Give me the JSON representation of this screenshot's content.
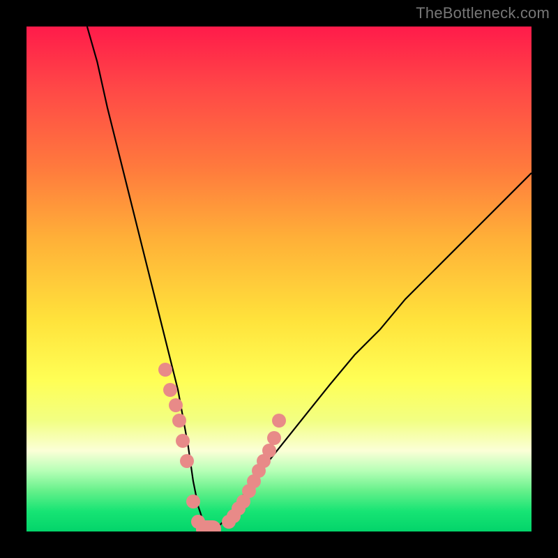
{
  "watermark": "TheBottleneck.com",
  "colors": {
    "frame": "#000000",
    "watermark_text": "#777777",
    "marker_fill": "#e88a88",
    "curve_stroke": "#000000"
  },
  "chart_data": {
    "type": "line",
    "title": "",
    "xlabel": "",
    "ylabel": "",
    "xlim": [
      0,
      100
    ],
    "ylim": [
      0,
      100
    ],
    "grid": false,
    "legend": false,
    "series": [
      {
        "name": "bottleneck_curve",
        "description": "V-shaped bottleneck curve; minimum near x≈35, y≈0",
        "x": [
          12,
          14,
          16,
          18,
          20,
          22,
          24,
          26,
          28,
          30,
          32,
          33,
          34,
          35,
          36,
          37,
          38,
          40,
          42,
          45,
          48,
          52,
          56,
          60,
          65,
          70,
          75,
          80,
          85,
          90,
          95,
          100
        ],
        "y": [
          100,
          93,
          84,
          76,
          68,
          60,
          52,
          44,
          36,
          28,
          17,
          10,
          5,
          2,
          1,
          0,
          1,
          3,
          6,
          10,
          14,
          19,
          24,
          29,
          35,
          40,
          46,
          51,
          56,
          61,
          66,
          71
        ]
      }
    ],
    "markers": {
      "name": "sampled_points",
      "description": "Salmon circular markers clustered near the bottom of the V",
      "x": [
        27.5,
        28.5,
        29.5,
        30.2,
        31,
        31.7,
        33,
        34,
        36,
        37,
        40,
        41,
        42,
        43,
        44,
        45,
        46,
        47,
        48,
        49,
        50
      ],
      "y": [
        32,
        28,
        25,
        22,
        18,
        14,
        6,
        2,
        0,
        0,
        2,
        3,
        4.5,
        6,
        8,
        10,
        12,
        14,
        16,
        18.5,
        22
      ]
    },
    "gap_pill": {
      "description": "Short thick salmon highlight along the flat minimum",
      "x_start": 33.5,
      "x_end": 38.5,
      "y": 0.5,
      "thickness_pct": 3.5
    }
  }
}
